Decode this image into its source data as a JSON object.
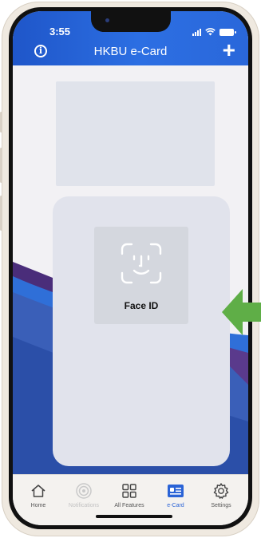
{
  "status_bar": {
    "time": "3:55"
  },
  "header": {
    "title": "HKBU e-Card",
    "info_glyph": "i",
    "add_glyph": "+"
  },
  "faceid": {
    "label": "Face ID"
  },
  "tabs": [
    {
      "label": "Home",
      "icon": "home-icon",
      "state": "normal"
    },
    {
      "label": "Notifications",
      "icon": "notifications-icon",
      "state": "disabled"
    },
    {
      "label": "All Features",
      "icon": "grid-icon",
      "state": "normal"
    },
    {
      "label": "e-Card",
      "icon": "ecard-icon",
      "state": "active"
    },
    {
      "label": "Settings",
      "icon": "gear-icon",
      "state": "normal"
    }
  ],
  "colors": {
    "header_blue": "#2c6fe3",
    "active_tab": "#2a63d6",
    "arrow_green": "#5fae47",
    "wave_purple": "#4a2d7a",
    "wave_blue": "#2f5fc7"
  }
}
